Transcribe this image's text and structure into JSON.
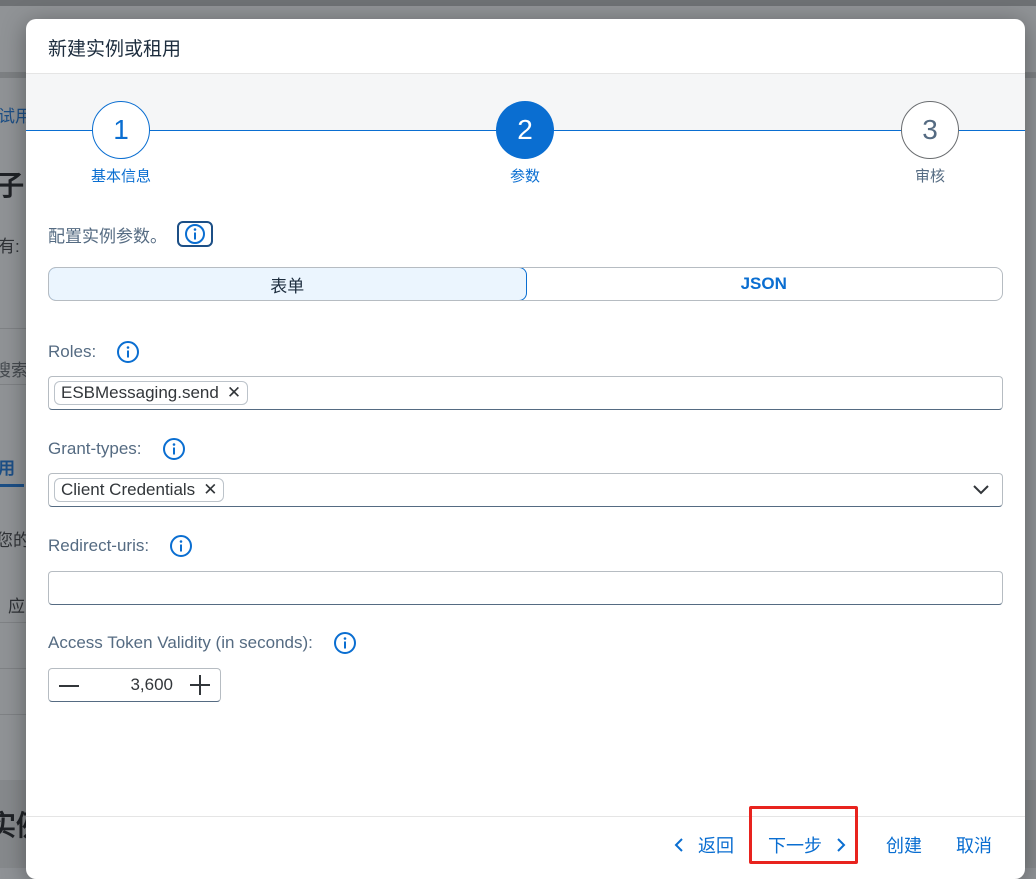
{
  "background": {
    "crumb_fragment": "试用",
    "heading_fragment": "子",
    "owner_fragment": "有:",
    "search_fragment": "搜索",
    "tab_fragment": "用",
    "desc_fragment": "您的",
    "col_fragment": "应",
    "section_fragment": "实例"
  },
  "dialog": {
    "title": "新建实例或租用",
    "wizard": {
      "steps": [
        {
          "number": "1",
          "label": "基本信息",
          "state": "completed"
        },
        {
          "number": "2",
          "label": "参数",
          "state": "current"
        },
        {
          "number": "3",
          "label": "审核",
          "state": "upcoming"
        }
      ]
    },
    "intro": "配置实例参数。",
    "mode_toggle": {
      "options": [
        "表单",
        "JSON"
      ],
      "selected": "表单"
    },
    "fields": {
      "roles": {
        "label": "Roles:",
        "tokens": [
          "ESBMessaging.send"
        ]
      },
      "grant_types": {
        "label": "Grant-types:",
        "tokens": [
          "Client Credentials"
        ]
      },
      "redirect_uris": {
        "label": "Redirect-uris:",
        "value": ""
      },
      "token_validity": {
        "label": "Access Token Validity (in seconds):",
        "value": "3,600"
      }
    },
    "footer": {
      "back_label": "返回",
      "next_label": "下一步",
      "create_label": "创建",
      "cancel_label": "取消"
    }
  },
  "colors": {
    "accent": "#0a6ed1",
    "highlight": "#e8231e",
    "text": "#32363a",
    "label": "#556b82"
  }
}
